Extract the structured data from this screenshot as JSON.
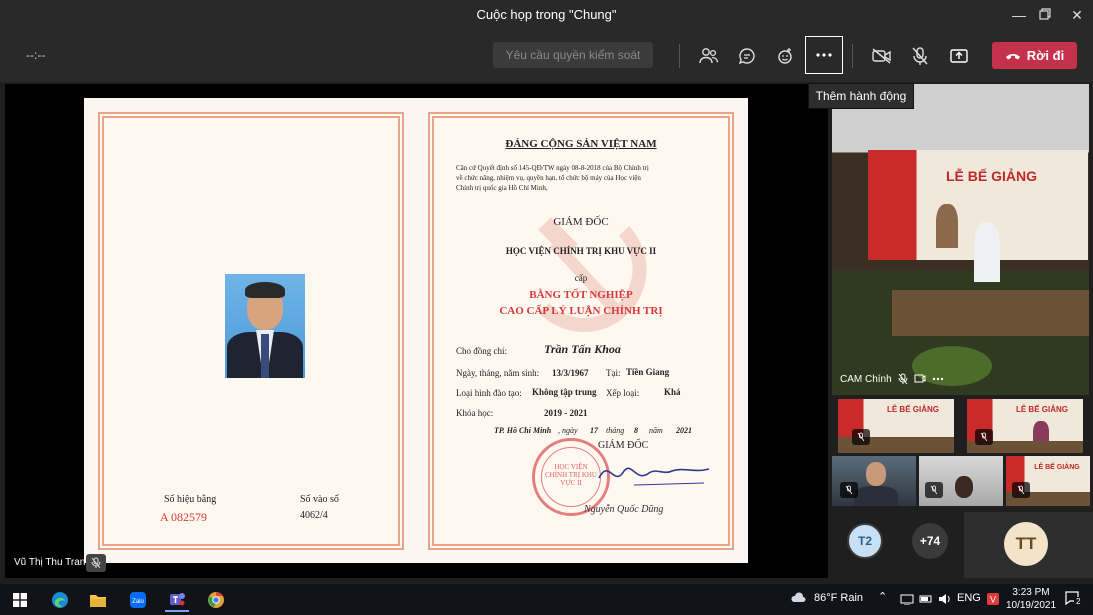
{
  "window": {
    "title": "Cuộc họp trong \"Chung\""
  },
  "toolbar": {
    "timer": "--:--",
    "request_control_label": "Yêu cầu quyền kiểm soát",
    "leave_label": "Rời đi",
    "more_tooltip": "Thêm hành động",
    "colors": {
      "leave": "#c4314b",
      "bar": "#292929"
    }
  },
  "presenter": {
    "name": "Vũ Thị Thu Trang"
  },
  "certificate": {
    "party": "ĐẢNG CỘNG SẢN VIỆT NAM",
    "preamble_1": "Căn cứ Quyết định số 145-QĐ/TW ngày 08-8-2018 của Bộ Chính trị",
    "preamble_2": "về chức năng, nhiệm vụ, quyền hạn, tổ chức bộ máy của Học viện",
    "preamble_3": "Chính trị quốc gia Hồ Chí Minh,",
    "director": "GIÁM ĐỐC",
    "institute": "HỌC VIỆN CHÍNH TRỊ KHU VỰC II",
    "grants": "cấp",
    "diploma_1": "BẰNG TỐT NGHIỆP",
    "diploma_2": "CAO CẤP LÝ LUẬN CHÍNH TRỊ",
    "to_label": "Cho đồng chí:",
    "to_value": "Trần Tấn Khoa",
    "dob_label": "Ngày, tháng, năm sinh:",
    "dob_value": "13/3/1967",
    "place_label": "Tại:",
    "place_value": "Tiền Giang",
    "type_label": "Loại hình đào tạo:",
    "type_value": "Không tập trung",
    "rank_label": "Xếp loại:",
    "rank_value": "Khá",
    "course_label": "Khóa học:",
    "course_value": "2019 - 2021",
    "city": "TP. Hồ Chí Minh",
    "date_day_label": ", ngày",
    "date_day": "17",
    "date_month_label": "tháng",
    "date_month": "8",
    "date_year_label": "năm",
    "date_year": "2021",
    "sign_title": "GIÁM ĐỐC",
    "signer": "Nguyễn Quốc Dũng",
    "seal_text": "HỌC VIỆN CHÍNH TRỊ KHU VỰC II",
    "number_label": "Số hiệu bằng",
    "number_value": "A 082579",
    "entry_label": "Số vào sổ",
    "entry_value": "4062/4"
  },
  "participants": {
    "main": {
      "name": "CAM Chính",
      "banner": "LỄ BẾ GIẢNG"
    },
    "small_banner": "LỄ BẾ GIẢNG",
    "avatars": [
      {
        "initials": "T2",
        "bg": "#c7e0f4",
        "fg": "#2b5f8a"
      },
      {
        "initials": "+74"
      },
      {
        "initials": "TT",
        "bg": "#f3e4c9",
        "fg": "#6b4b1e"
      }
    ]
  },
  "taskbar": {
    "weather": "86°F  Rain",
    "lang": "ENG",
    "time": "3:23 PM",
    "date": "10/19/2021",
    "notif_count": "2"
  }
}
